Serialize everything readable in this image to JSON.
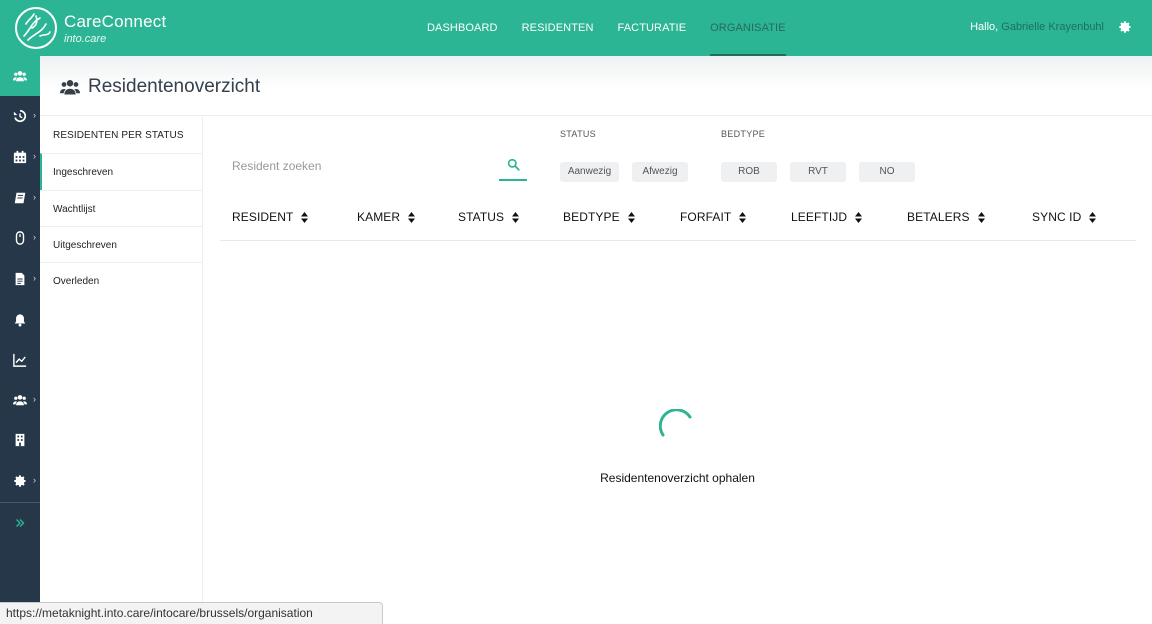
{
  "app": {
    "brand_name": "CareConnect",
    "brand_sub": "into.care",
    "accent": "#2bb594",
    "sidebar_bg": "#253748"
  },
  "nav": {
    "items": [
      "DASHBOARD",
      "RESIDENTEN",
      "FACTURATIE",
      "ORGANISATIE"
    ],
    "active": "ORGANISATIE"
  },
  "user": {
    "greeting": "Hallo,",
    "name": "Gabrielle Krayenbuhl"
  },
  "sidebar": {
    "icons": [
      "users-icon",
      "history-icon",
      "calendar-icon",
      "book-icon",
      "mouse-icon",
      "file-icon",
      "bell-icon",
      "chart-icon",
      "group-icon",
      "building-icon",
      "gear-icon",
      "expand-icon"
    ]
  },
  "page": {
    "title": "Residentenoverzicht"
  },
  "status_panel": {
    "heading": "RESIDENTEN PER STATUS",
    "items": [
      "Ingeschreven",
      "Wachtlijst",
      "Uitgeschreven",
      "Overleden"
    ]
  },
  "search": {
    "placeholder": "Resident zoeken",
    "value": ""
  },
  "filters": {
    "status_label": "STATUS",
    "status_options": [
      "Aanwezig",
      "Afwezig"
    ],
    "bedtype_label": "BEDTYPE",
    "bedtype_options": [
      "ROB",
      "RVT",
      "NO"
    ]
  },
  "table": {
    "columns": [
      "RESIDENT",
      "KAMER",
      "STATUS",
      "BEDTYPE",
      "FORFAIT",
      "LEEFTIJD",
      "BETALERS",
      "SYNC ID"
    ]
  },
  "loading": {
    "text": "Residentenoverzicht ophalen"
  },
  "status_bar": {
    "url": "https://metaknight.into.care/intocare/brussels/organisation"
  }
}
